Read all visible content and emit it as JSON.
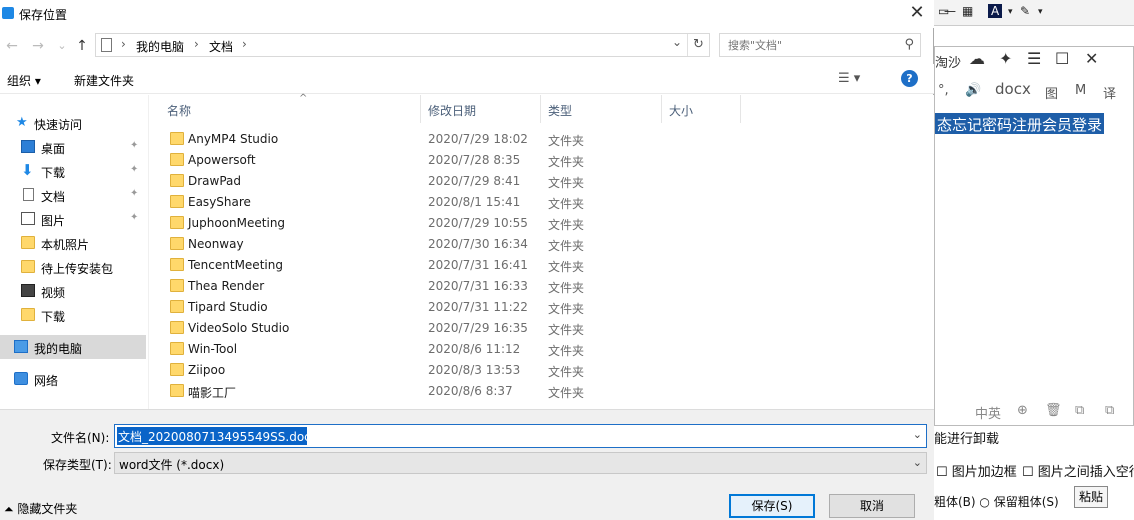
{
  "dialog": {
    "title": "保存位置",
    "close_glyph": "✕"
  },
  "address": {
    "back_glyph": "←",
    "forward_glyph": "→",
    "recent_glyph": "⌄",
    "up_glyph": "↑",
    "crumbs": [
      "我的电脑",
      "文档"
    ],
    "sep_glyph": "›",
    "dropdown_glyph": "⌄",
    "refresh_glyph": "↻"
  },
  "search": {
    "placeholder": "搜索\"文档\"",
    "icon": "search-icon"
  },
  "toolbar": {
    "organize_label": "组织 ▾",
    "new_folder_label": "新建文件夹",
    "view_glyph": "☰ ▾",
    "help_glyph": "?"
  },
  "nav": {
    "items": [
      {
        "label": "快速访问",
        "icon": "star-icon"
      },
      {
        "label": "桌面",
        "icon": "desktop-icon",
        "pinned": true
      },
      {
        "label": "下载",
        "icon": "download-icon",
        "pinned": true
      },
      {
        "label": "文档",
        "icon": "document-icon",
        "pinned": true
      },
      {
        "label": "图片",
        "icon": "picture-icon",
        "pinned": true
      },
      {
        "label": "本机照片",
        "icon": "folder-icon"
      },
      {
        "label": "待上传安装包",
        "icon": "folder-icon"
      },
      {
        "label": "视频",
        "icon": "video-icon"
      },
      {
        "label": "下载",
        "icon": "folder-icon"
      },
      {
        "label": "我的电脑",
        "icon": "computer-icon",
        "selected": true
      },
      {
        "label": "网络",
        "icon": "network-icon"
      }
    ],
    "pin_glyph": "📌"
  },
  "files": {
    "columns": [
      "名称",
      "修改日期",
      "类型",
      "大小"
    ],
    "sort_glyph": "^",
    "rows": [
      {
        "name": "AnyMP4 Studio",
        "date": "2020/7/29 18:02",
        "type": "文件夹"
      },
      {
        "name": "Apowersoft",
        "date": "2020/7/28 8:35",
        "type": "文件夹"
      },
      {
        "name": "DrawPad",
        "date": "2020/7/29 8:41",
        "type": "文件夹"
      },
      {
        "name": "EasyShare",
        "date": "2020/8/1 15:41",
        "type": "文件夹"
      },
      {
        "name": "JuphoonMeeting",
        "date": "2020/7/29 10:55",
        "type": "文件夹"
      },
      {
        "name": "Neonway",
        "date": "2020/7/30 16:34",
        "type": "文件夹"
      },
      {
        "name": "TencentMeeting",
        "date": "2020/7/31 16:41",
        "type": "文件夹"
      },
      {
        "name": "Thea Render",
        "date": "2020/7/31 16:33",
        "type": "文件夹"
      },
      {
        "name": "Tipard Studio",
        "date": "2020/7/31 11:22",
        "type": "文件夹"
      },
      {
        "name": "VideoSolo Studio",
        "date": "2020/7/29 16:35",
        "type": "文件夹"
      },
      {
        "name": "Win-Tool",
        "date": "2020/8/6 11:12",
        "type": "文件夹"
      },
      {
        "name": "Ziipoo",
        "date": "2020/8/3 13:53",
        "type": "文件夹"
      },
      {
        "name": "喵影工厂",
        "date": "2020/8/6 8:37",
        "type": "文件夹"
      }
    ]
  },
  "save": {
    "filename_label": "文件名(N):",
    "filename_value": "文档_2020080713495549SS.docx",
    "filetype_label": "保存类型(T):",
    "filetype_value": "word文件 (*.docx)",
    "dropdown_glyph": "⌄",
    "hide_folders_label": "⏶ 隐藏文件夹",
    "save_label": "保存(S)",
    "cancel_label": "取消"
  },
  "background_app": {
    "toolbar": [
      "▭",
      "—",
      "▦",
      "A",
      "▾",
      "✎",
      "▾"
    ],
    "panel_title": "淘沙",
    "panel_buttons": [
      "☁",
      "✦",
      "☰",
      "☐",
      "✕"
    ],
    "panel_line2": [
      "°,",
      "🔊",
      "docx",
      "图",
      "M",
      "译"
    ],
    "selected_text": "态忘记密码注册会员登录",
    "panel_bottom": [
      "中英",
      "⊕",
      "🗑",
      "⧉",
      "⧉"
    ],
    "uninstall_text": "能进行卸载",
    "check1": "☐ 图片加边框",
    "check2": "☐ 图片之间插入空行",
    "radio_text": "粗体(B) ○ 保留粗体(S)",
    "paste_label": "粘贴"
  },
  "colors": {
    "selection": "#0a64c8",
    "folder": "#ffd86b",
    "primary_border": "#0078d7",
    "help": "#1e6fc7"
  }
}
